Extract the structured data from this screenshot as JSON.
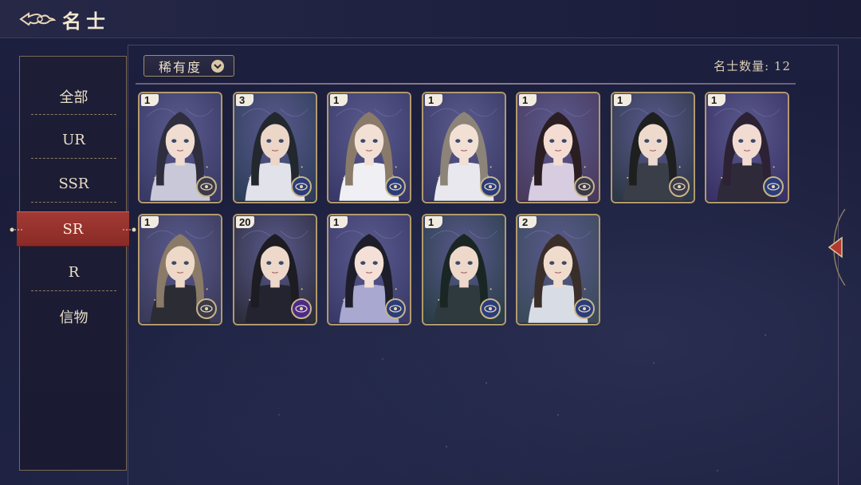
{
  "header": {
    "title": "名士"
  },
  "sidebar": {
    "items": [
      {
        "label": "全部",
        "active": false
      },
      {
        "label": "UR",
        "active": false
      },
      {
        "label": "SSR",
        "active": false
      },
      {
        "label": "SR",
        "active": true
      },
      {
        "label": "R",
        "active": false
      },
      {
        "label": "信物",
        "active": false
      }
    ]
  },
  "filter": {
    "label": "稀有度",
    "icon": "chevron-down-icon"
  },
  "summary": {
    "count_label": "名士数量: 12"
  },
  "cards": [
    {
      "count": "1",
      "hair": "#2e2e3e",
      "skin": "#f0dcd0",
      "bg": "#3a3a66",
      "badge": "gray",
      "robe": "#c8c8d8"
    },
    {
      "count": "3",
      "hair": "#23282e",
      "skin": "#ecd6c8",
      "bg": "#2e3e5a",
      "badge": "blue",
      "robe": "#e2e2ea"
    },
    {
      "count": "1",
      "hair": "#8a7a6a",
      "skin": "#f2e0d4",
      "bg": "#3a3a6a",
      "badge": "blue",
      "robe": "#f0f0f4"
    },
    {
      "count": "1",
      "hair": "#8c8478",
      "skin": "#f2e0d4",
      "bg": "#3a3a66",
      "badge": "blue",
      "robe": "#e8e8ee"
    },
    {
      "count": "1",
      "hair": "#2a1e22",
      "skin": "#f4dcd2",
      "bg": "#4a3a5e",
      "badge": "gray",
      "robe": "#d8cce0"
    },
    {
      "count": "1",
      "hair": "#1e2020",
      "skin": "#eedacc",
      "bg": "#2e3848",
      "badge": "gray",
      "robe": "#3a3e48"
    },
    {
      "count": "1",
      "hair": "#2c2234",
      "skin": "#f2dcd2",
      "bg": "#3a3266",
      "badge": "blue",
      "robe": "#2e2a3a"
    },
    {
      "count": "1",
      "hair": "#8a7a68",
      "skin": "#eed8c8",
      "bg": "#3a3a5a",
      "badge": "gray",
      "robe": "#2c2c34"
    },
    {
      "count": "20",
      "hair": "#1c1c22",
      "skin": "#eed8ca",
      "bg": "#2e2e3e",
      "badge": "purple",
      "robe": "#242430"
    },
    {
      "count": "1",
      "hair": "#1e1e2a",
      "skin": "#f4e0d6",
      "bg": "#3a3a6a",
      "badge": "blue",
      "robe": "#a8a8d0"
    },
    {
      "count": "1",
      "hair": "#1a2624",
      "skin": "#eed8ca",
      "bg": "#2a3e48",
      "badge": "blue",
      "robe": "#2e3a3e"
    },
    {
      "count": "2",
      "hair": "#3a2e2a",
      "skin": "#f0dccc",
      "bg": "#3a4a5a",
      "badge": "blue",
      "robe": "#d8dce4"
    }
  ],
  "colors": {
    "accent_red": "#a23a34",
    "gold_border": "#b29a6c",
    "panel_bg": "#1d1d36"
  }
}
